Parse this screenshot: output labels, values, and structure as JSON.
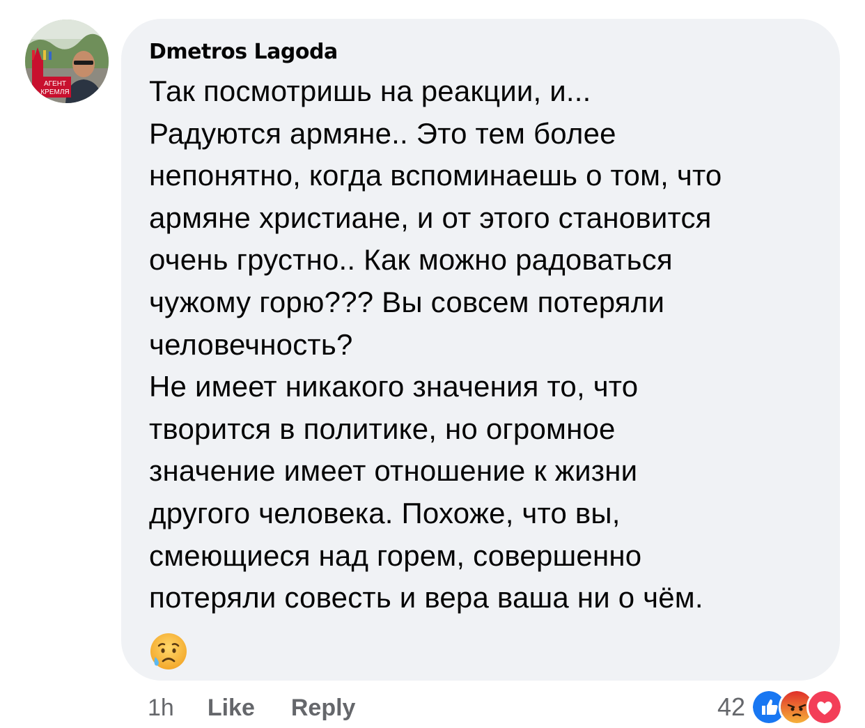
{
  "comment": {
    "author": "Dmetros Lagoda",
    "avatar_badge_text": [
      "АГЕНТ",
      "КРЕМЛЯ"
    ],
    "lines": [
      "Так посмотришь на реакции, и...",
      "Радуются армяне.. Это тем более",
      "непонятно, когда вспоминаешь о том, что",
      "армяне христиане, и от этого становится",
      "очень грустно.. Как можно радоваться",
      "чужому горю??? Вы совсем потеряли",
      "человечность?",
      "Не имеет никакого значения то, что",
      "творится в политике, но огромное",
      "значение имеет отношение к жизни",
      "другого человека. Похоже, что вы,",
      "смеющиеся над горем, совершенно",
      "потеряли совесть и вера ваша ни о чём."
    ],
    "trailing_emoji": "sad-tear-face-emoji"
  },
  "actions": {
    "time": "1h",
    "like": "Like",
    "reply": "Reply"
  },
  "reactions": {
    "count": "42",
    "types": [
      "like",
      "angry",
      "love"
    ],
    "colors": {
      "like": "#1877f2",
      "angry": "#e9710f",
      "love": "#f33e58",
      "bubble": "#f0f2f5",
      "meta_text": "#65676b"
    }
  }
}
